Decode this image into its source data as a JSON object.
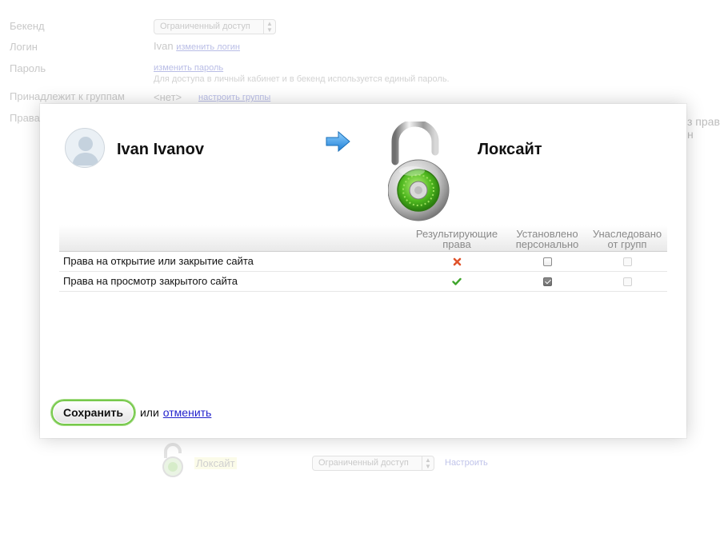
{
  "background": {
    "backend_label": "Бекенд",
    "backend_value": "Ограниченный доступ",
    "login_label": "Логин",
    "login_value": "Ivan",
    "change_login_link": "изменить логин",
    "password_label": "Пароль",
    "change_password_link": "изменить пароль",
    "password_note": "Для доступа в личный кабинет и в бекенд используется единый пароль.",
    "groups_label": "Принадлежит к группам",
    "groups_value": "<нет>",
    "configure_groups_link": "настроить группы",
    "rights_label": "Права",
    "rights_tail": "з прав н",
    "site_row_name": "Локсайт",
    "site_row_value": "Ограниченный доступ",
    "site_row_configure": "Настроить"
  },
  "dialog": {
    "user_name": "Ivan Ivanov",
    "site_name": "Локсайт",
    "table": {
      "headers": {
        "resulting": [
          "Результирующие",
          "права"
        ],
        "personal": [
          "Установлено",
          "персонально"
        ],
        "inherited": [
          "Унаследовано",
          "от групп"
        ]
      },
      "rows": [
        {
          "label": "Права на открытие или закрытие сайта",
          "resulting": "deny",
          "personal": false,
          "inherited": false
        },
        {
          "label": "Права на просмотр закрытого сайта",
          "resulting": "allow",
          "personal": true,
          "inherited": false
        }
      ]
    },
    "footer": {
      "save_label": "Сохранить",
      "or_text": "или",
      "cancel_label": "отменить"
    }
  },
  "icons": {
    "avatar": "user-avatar-icon",
    "arrow": "right-arrow-icon",
    "lock": "open-padlock-icon",
    "deny": "red-cross-icon",
    "allow": "green-check-icon"
  },
  "colors": {
    "accent_green": "#77c94c",
    "link_blue": "#2222cc",
    "deny_red": "#e0532b",
    "allow_green": "#3fa52c"
  }
}
